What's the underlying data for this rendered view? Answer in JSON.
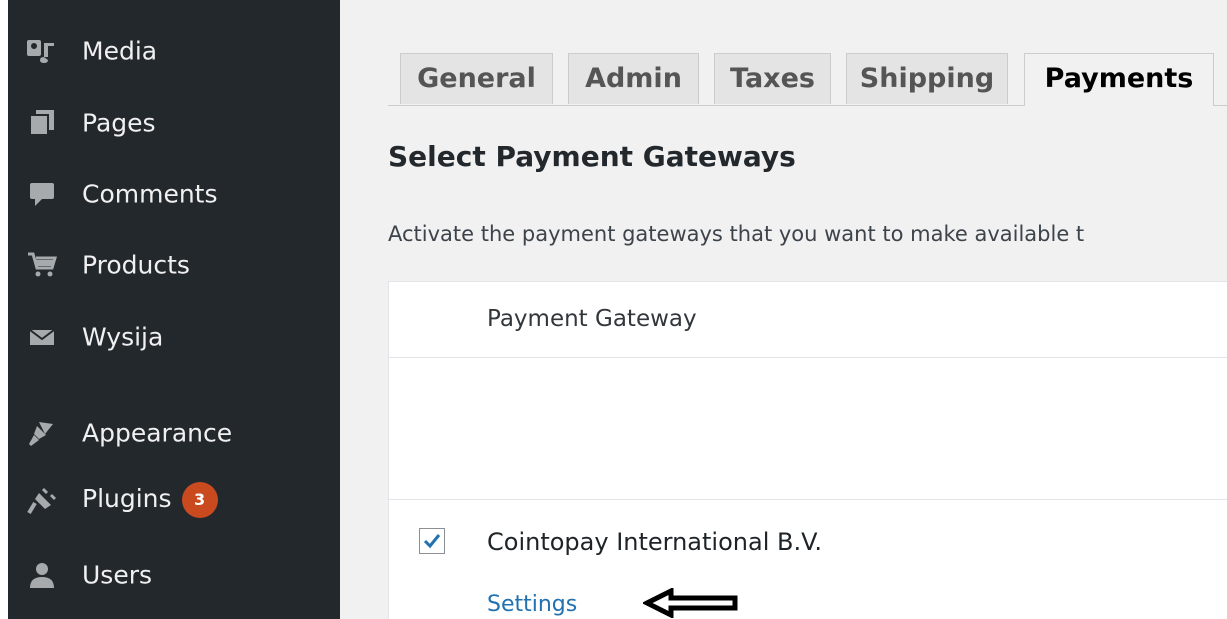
{
  "sidebar": {
    "items": [
      {
        "label": "Media",
        "icon": "media-icon"
      },
      {
        "label": "Pages",
        "icon": "pages-icon"
      },
      {
        "label": "Comments",
        "icon": "comments-icon"
      },
      {
        "label": "Products",
        "icon": "cart-icon"
      },
      {
        "label": "Wysija",
        "icon": "envelope-icon"
      },
      {
        "label": "Appearance",
        "icon": "paintbrush-icon"
      },
      {
        "label": "Plugins",
        "icon": "plug-icon",
        "badge": "3"
      },
      {
        "label": "Users",
        "icon": "users-icon"
      }
    ]
  },
  "tabs": [
    {
      "label": "General"
    },
    {
      "label": "Admin"
    },
    {
      "label": "Taxes"
    },
    {
      "label": "Shipping"
    },
    {
      "label": "Payments",
      "active": true
    }
  ],
  "page": {
    "title": "Select Payment Gateways",
    "description": "Activate the payment gateways that you want to make available t"
  },
  "table": {
    "header": "Payment Gateway",
    "rows": [
      {
        "name": "Cointopay International B.V.",
        "checked": true,
        "settings_label": "Settings"
      }
    ]
  },
  "colors": {
    "sidebar_bg": "#23282d",
    "badge_bg": "#ca4a1f",
    "link": "#2271b1",
    "checkmark": "#2271b1"
  }
}
